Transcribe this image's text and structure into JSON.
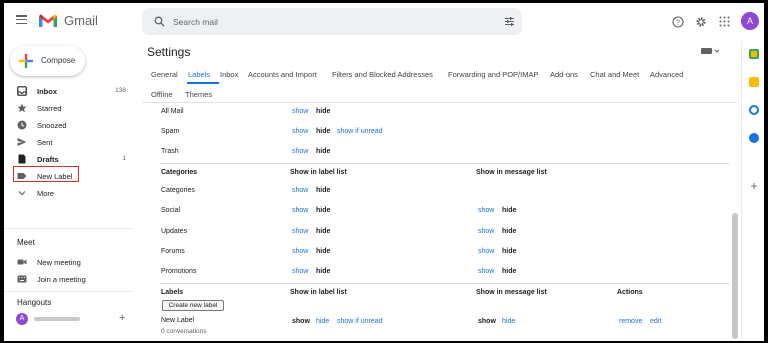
{
  "app": {
    "name": "Gmail",
    "avatar_initial": "A"
  },
  "search": {
    "placeholder": "Search mail"
  },
  "compose": {
    "label": "Compose"
  },
  "sidebar": {
    "items": [
      {
        "label": "Inbox",
        "count": "138",
        "icon": "inbox-icon",
        "bold": true
      },
      {
        "label": "Starred",
        "count": "",
        "icon": "star-icon"
      },
      {
        "label": "Snoozed",
        "count": "",
        "icon": "clock-icon"
      },
      {
        "label": "Sent",
        "count": "",
        "icon": "send-icon"
      },
      {
        "label": "Drafts",
        "count": "1",
        "icon": "draft-icon",
        "bold": true
      },
      {
        "label": "New Label",
        "count": "",
        "icon": "label-icon"
      },
      {
        "label": "More",
        "count": "",
        "icon": "chevron-down-icon"
      }
    ],
    "meet": {
      "title": "Meet",
      "new_meeting": "New meeting",
      "join_meeting": "Join a meeting"
    },
    "hangouts": {
      "title": "Hangouts",
      "avatar_initial": "A"
    }
  },
  "settings": {
    "title": "Settings",
    "tabs": [
      "General",
      "Labels",
      "Inbox",
      "Accounts and Import",
      "Filters and Blocked Addresses",
      "Forwarding and POP/IMAP",
      "Add-ons",
      "Chat and Meet",
      "Advanced",
      "Offline",
      "Themes"
    ],
    "active_tab": "Labels",
    "system_rows": [
      {
        "name": "All Mail",
        "links": [
          "show",
          "hide"
        ]
      },
      {
        "name": "Spam",
        "links": [
          "show",
          "hide",
          "show if unread"
        ]
      },
      {
        "name": "Trash",
        "links": [
          "show",
          "hide"
        ]
      }
    ],
    "categories_header": {
      "col1": "Categories",
      "col2": "Show in label list",
      "col3": "Show in message list"
    },
    "categories": [
      {
        "name": "Categories",
        "list": [
          "show",
          "hide"
        ],
        "msg": []
      },
      {
        "name": "Social",
        "list": [
          "show",
          "hide"
        ],
        "msg": [
          "show",
          "hide"
        ]
      },
      {
        "name": "Updates",
        "list": [
          "show",
          "hide"
        ],
        "msg": [
          "show",
          "hide"
        ]
      },
      {
        "name": "Forums",
        "list": [
          "show",
          "hide"
        ],
        "msg": [
          "show",
          "hide"
        ]
      },
      {
        "name": "Promotions",
        "list": [
          "show",
          "hide"
        ],
        "msg": [
          "show",
          "hide"
        ]
      }
    ],
    "labels_header": {
      "col1": "Labels",
      "col2": "Show in label list",
      "col3": "Show in message list",
      "col4": "Actions"
    },
    "create_button": "Create new label",
    "labels": [
      {
        "name": "New Label",
        "sub": "0 conversations",
        "list": [
          "show",
          "hide",
          "show if unread"
        ],
        "msg": [
          "show",
          "hide"
        ],
        "actions": [
          "remove",
          "edit"
        ]
      }
    ]
  },
  "colors": {
    "accent": "#1a73e8",
    "highlight": "#d93025",
    "avatar": "#8e48d6"
  }
}
